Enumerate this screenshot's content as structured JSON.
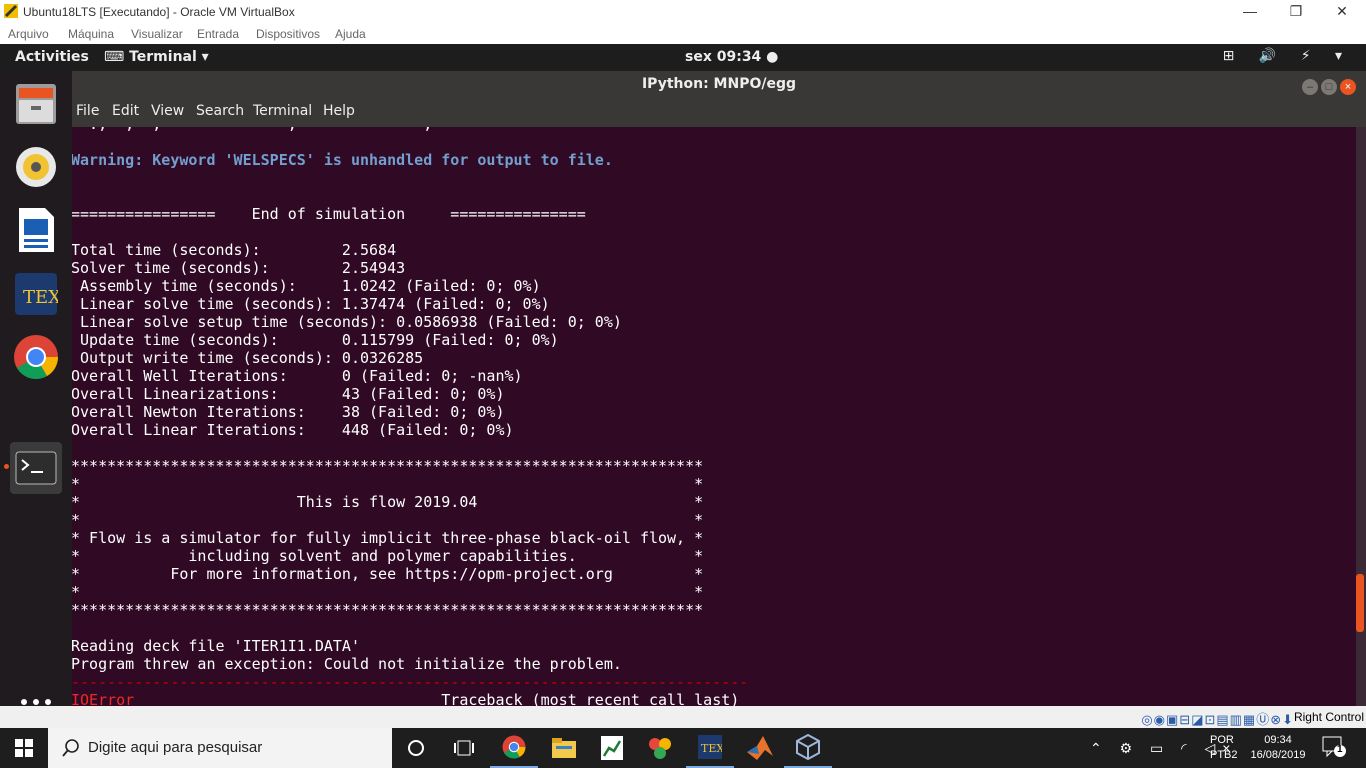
{
  "vbox": {
    "title": "Ubuntu18LTS [Executando] - Oracle VM VirtualBox",
    "menu": [
      "Arquivo",
      "Máquina",
      "Visualizar",
      "Entrada",
      "Dispositivos",
      "Ajuda"
    ],
    "host_key": "Right Control"
  },
  "ubuntu": {
    "activities": "Activities",
    "app_menu": "Terminal ▾",
    "clock": "sex 09:34 ●",
    "tray": "⊞ 🔊 ⚡ ▾"
  },
  "terminal": {
    "title": "IPython: MNPO/egg",
    "menu": [
      "File",
      "Edit",
      "View",
      "Search",
      "Terminal",
      "Help"
    ],
    "lines": {
      "partial_top": "  .,  ,  ,              ,              ,",
      "warning": "Warning: Keyword 'WELSPECS' is unhandled for output to file.",
      "end_sim": "================    End of simulation     ===============",
      "total_time": "Total time (seconds):         2.5684",
      "solver_time": "Solver time (seconds):        2.54943",
      "assembly_time": " Assembly time (seconds):     1.0242 (Failed: 0; 0%)",
      "linear_solve_time": " Linear solve time (seconds): 1.37474 (Failed: 0; 0%)",
      "linear_setup_time": " Linear solve setup time (seconds): 0.0586938 (Failed: 0; 0%)",
      "update_time": " Update time (seconds):       0.115799 (Failed: 0; 0%)",
      "output_time": " Output write time (seconds): 0.0326285",
      "well_iter": "Overall Well Iterations:      0 (Failed: 0; -nan%)",
      "linearizations": "Overall Linearizations:       43 (Failed: 0; 0%)",
      "newton_iter": "Overall Newton Iterations:    38 (Failed: 0; 0%)",
      "linear_iter": "Overall Linear Iterations:    448 (Failed: 0; 0%)",
      "stars": "**********************************************************************",
      "star_blank": "*                                                                    *",
      "flow_title": "*                        This is flow 2019.04                        *",
      "flow_desc1": "* Flow is a simulator for fully implicit three-phase black-oil flow, *",
      "flow_desc2": "*            including solvent and polymer capabilities.             *",
      "flow_desc3": "*          For more information, see https://opm-project.org         *",
      "reading_deck": "Reading deck file 'ITER1I1.DATA'",
      "exception": "Program threw an exception: Could not initialize the problem.",
      "dashes": "---------------------------------------------------------------------------",
      "ioerror": "IOError",
      "traceback": "Traceback (most recent call last)",
      "partial_bottom": " ,        ,  ,           ,            ,  , ,  ,"
    }
  },
  "taskbar": {
    "search_placeholder": "Digite aqui para pesquisar",
    "lang_top": "POR",
    "lang_bottom": "PTB2",
    "time": "09:34",
    "date": "16/08/2019",
    "notif_count": "1"
  }
}
